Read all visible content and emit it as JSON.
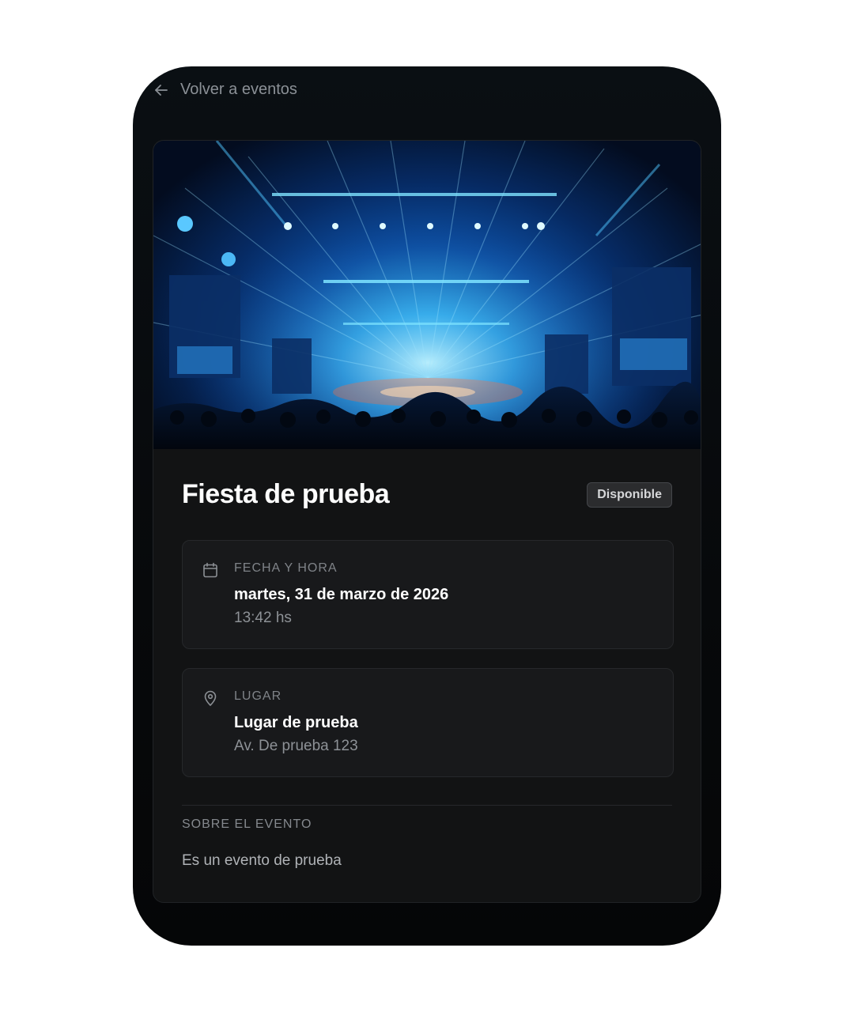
{
  "nav": {
    "back_label": "Volver a eventos",
    "back_icon": "arrow-left-icon"
  },
  "event": {
    "title": "Fiesta de prueba",
    "status_badge": "Disponible",
    "hero_image": "concert-stage-blue-lights"
  },
  "date_time": {
    "icon": "calendar-icon",
    "label": "FECHA Y HORA",
    "date": "martes, 31 de marzo de 2026",
    "time": "13:42 hs"
  },
  "place": {
    "icon": "map-pin-icon",
    "label": "LUGAR",
    "name": "Lugar de prueba",
    "address": "Av. De prueba 123"
  },
  "about": {
    "label": "SOBRE EL EVENTO",
    "description": "Es un evento de prueba"
  },
  "colors": {
    "background": "#07090b",
    "card": "#121314",
    "accent_blue": "#2aa6e8"
  }
}
